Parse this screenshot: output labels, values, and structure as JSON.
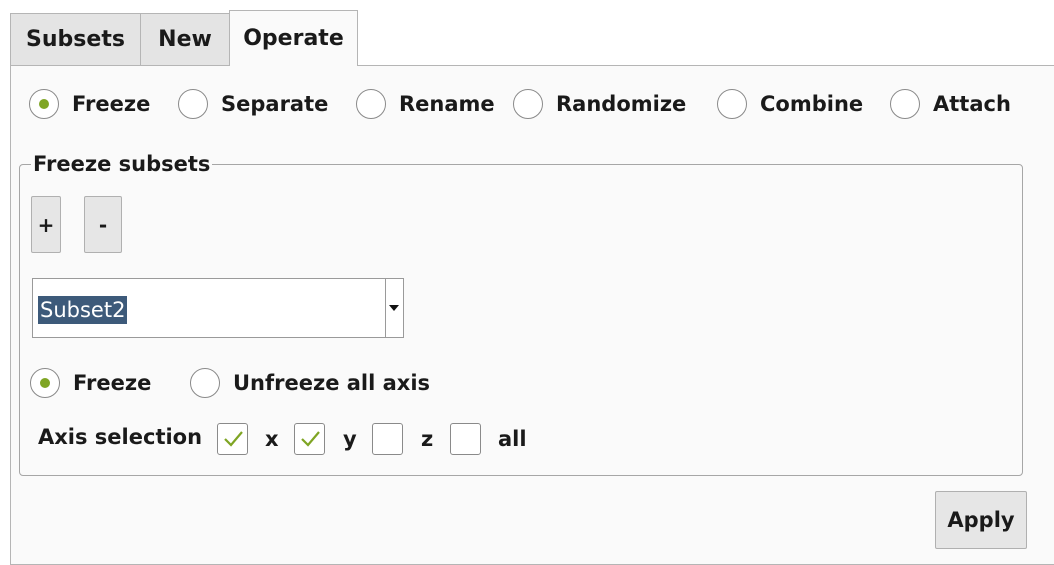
{
  "tabs": [
    {
      "label": "Subsets",
      "active": false
    },
    {
      "label": "New",
      "active": false
    },
    {
      "label": "Operate",
      "active": true
    }
  ],
  "operations": [
    {
      "label": "Freeze",
      "selected": true
    },
    {
      "label": "Separate",
      "selected": false
    },
    {
      "label": "Rename",
      "selected": false
    },
    {
      "label": "Randomize",
      "selected": false
    },
    {
      "label": "Combine",
      "selected": false
    },
    {
      "label": "Attach",
      "selected": false
    }
  ],
  "freeze_group": {
    "title": "Freeze subsets",
    "add_label": "+",
    "remove_label": "-",
    "subset_selected": "Subset2",
    "modes": [
      {
        "label": "Freeze",
        "selected": true
      },
      {
        "label": "Unfreeze all axis",
        "selected": false
      }
    ],
    "axis_selection_label": "Axis selection",
    "axes": [
      {
        "label": "x",
        "checked": true
      },
      {
        "label": "y",
        "checked": true
      },
      {
        "label": "z",
        "checked": false
      },
      {
        "label": "all",
        "checked": false
      }
    ]
  },
  "apply_label": "Apply",
  "colors": {
    "accent": "#7fa524",
    "selection": "#3d5a7a",
    "tab_bg": "#e4e4e4",
    "panel_bg": "#fafafa"
  }
}
